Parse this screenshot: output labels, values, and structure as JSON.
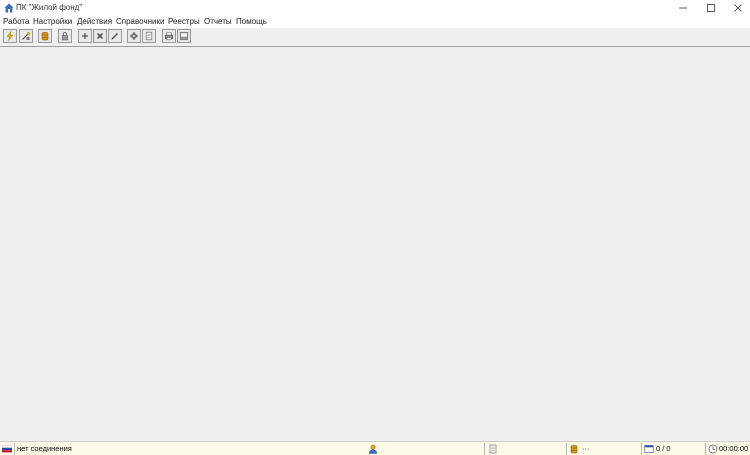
{
  "window": {
    "title": "ПК \"Жилой фонд\""
  },
  "menu": {
    "items": [
      "Работа",
      "Настройки",
      "Действия",
      "Справочники",
      "Реестры",
      "Отчеты",
      "Помощь"
    ]
  },
  "toolbar": {
    "buttons": [
      {
        "icon": "lightning-icon"
      },
      {
        "icon": "settings-wand-icon"
      },
      {
        "icon": "database-icon"
      },
      {
        "icon": "lock-icon"
      },
      {
        "icon": "add-icon"
      },
      {
        "icon": "delete-icon"
      },
      {
        "icon": "edit-icon"
      },
      {
        "icon": "gear-icon"
      },
      {
        "icon": "document-icon"
      },
      {
        "icon": "print-icon"
      },
      {
        "icon": "print-preview-icon"
      }
    ]
  },
  "status": {
    "connection": "нет соединения",
    "db_value": "···",
    "counter": "0 / 0",
    "timer": "00:00:00"
  },
  "colors": {
    "workspace": "#f0f0f0",
    "statusbar": "#fbfbe8",
    "accent_lightning": "#e0b000",
    "accent_db": "#d79a18"
  }
}
